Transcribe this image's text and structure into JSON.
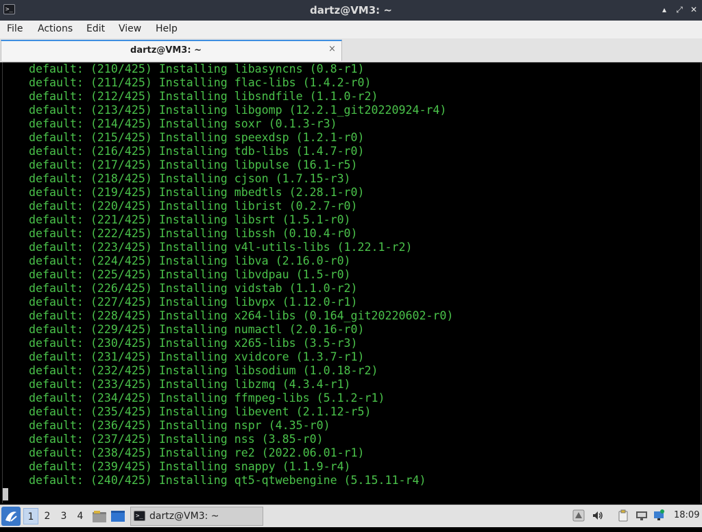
{
  "window": {
    "icon_glyph": ">_",
    "title": "dartz@VM3: ~",
    "controls": {
      "minimize": "▴",
      "maximize": "⤢",
      "close": "✕"
    }
  },
  "menubar": [
    "File",
    "Actions",
    "Edit",
    "View",
    "Help"
  ],
  "tab": {
    "label": "dartz@VM3: ~",
    "close": "×"
  },
  "terminal": {
    "text_color": "#4ac24a",
    "lines": [
      "default: (210/425) Installing libasyncns (0.8-r1)",
      "default: (211/425) Installing flac-libs (1.4.2-r0)",
      "default: (212/425) Installing libsndfile (1.1.0-r2)",
      "default: (213/425) Installing libgomp (12.2.1_git20220924-r4)",
      "default: (214/425) Installing soxr (0.1.3-r3)",
      "default: (215/425) Installing speexdsp (1.2.1-r0)",
      "default: (216/425) Installing tdb-libs (1.4.7-r0)",
      "default: (217/425) Installing libpulse (16.1-r5)",
      "default: (218/425) Installing cjson (1.7.15-r3)",
      "default: (219/425) Installing mbedtls (2.28.1-r0)",
      "default: (220/425) Installing librist (0.2.7-r0)",
      "default: (221/425) Installing libsrt (1.5.1-r0)",
      "default: (222/425) Installing libssh (0.10.4-r0)",
      "default: (223/425) Installing v4l-utils-libs (1.22.1-r2)",
      "default: (224/425) Installing libva (2.16.0-r0)",
      "default: (225/425) Installing libvdpau (1.5-r0)",
      "default: (226/425) Installing vidstab (1.1.0-r2)",
      "default: (227/425) Installing libvpx (1.12.0-r1)",
      "default: (228/425) Installing x264-libs (0.164_git20220602-r0)",
      "default: (229/425) Installing numactl (2.0.16-r0)",
      "default: (230/425) Installing x265-libs (3.5-r3)",
      "default: (231/425) Installing xvidcore (1.3.7-r1)",
      "default: (232/425) Installing libsodium (1.0.18-r2)",
      "default: (233/425) Installing libzmq (4.3.4-r1)",
      "default: (234/425) Installing ffmpeg-libs (5.1.2-r1)",
      "default: (235/425) Installing libevent (2.1.12-r5)",
      "default: (236/425) Installing nspr (4.35-r0)",
      "default: (237/425) Installing nss (3.85-r0)",
      "default: (238/425) Installing re2 (2022.06.01-r1)",
      "default: (239/425) Installing snappy (1.1.9-r4)",
      "default: (240/425) Installing qt5-qtwebengine (5.15.11-r4)"
    ]
  },
  "taskbar": {
    "workspaces": [
      "1",
      "2",
      "3",
      "4"
    ],
    "active_workspace": "1",
    "task_label": "dartz@VM3: ~",
    "task_icon_glyph": ">_",
    "clock": "18:09"
  }
}
